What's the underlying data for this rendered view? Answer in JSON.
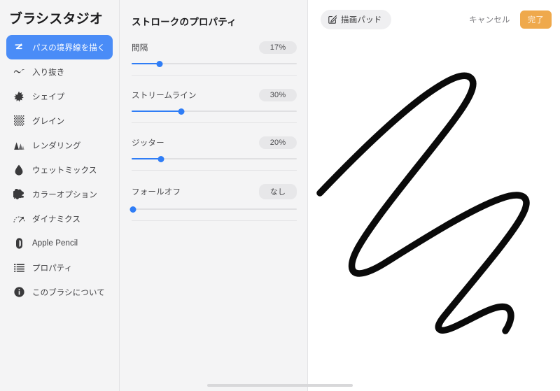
{
  "sidebar": {
    "title": "ブラシスタジオ",
    "items": [
      {
        "label": "パスの境界線を描く",
        "icon": "path-stroke-icon",
        "selected": true
      },
      {
        "label": "入り抜き",
        "icon": "taper-wave-icon",
        "selected": false
      },
      {
        "label": "シェイプ",
        "icon": "shape-burst-icon",
        "selected": false
      },
      {
        "label": "グレイン",
        "icon": "grain-dots-icon",
        "selected": false
      },
      {
        "label": "レンダリング",
        "icon": "rendering-layers-icon",
        "selected": false
      },
      {
        "label": "ウェットミックス",
        "icon": "water-drop-icon",
        "selected": false
      },
      {
        "label": "カラーオプション",
        "icon": "color-splat-icon",
        "selected": false
      },
      {
        "label": "ダイナミクス",
        "icon": "dynamics-gauge-icon",
        "selected": false
      },
      {
        "label": "Apple Pencil",
        "icon": "apple-pencil-icon",
        "selected": false
      },
      {
        "label": "プロパティ",
        "icon": "properties-list-icon",
        "selected": false
      },
      {
        "label": "このブラシについて",
        "icon": "info-circle-icon",
        "selected": false
      }
    ]
  },
  "properties": {
    "title": "ストロークのプロパティ",
    "sliders": [
      {
        "label": "間隔",
        "value": "17%",
        "percent": 17
      },
      {
        "label": "ストリームライン",
        "value": "30%",
        "percent": 30
      },
      {
        "label": "ジッター",
        "value": "20%",
        "percent": 20
      },
      {
        "label": "フォールオフ",
        "value": "なし",
        "percent": 0
      }
    ]
  },
  "canvas": {
    "pad_button_label": "描画パッド",
    "pad_button_icon": "edit-square-icon",
    "cancel_label": "キャンセル",
    "done_label": "完了",
    "stroke_color": "#0a0a0a"
  },
  "colors": {
    "accent_blue": "#4a8cf7",
    "slider_blue": "#2f7df6",
    "done_orange": "#efa94c",
    "panel_bg": "#f4f4f5"
  }
}
